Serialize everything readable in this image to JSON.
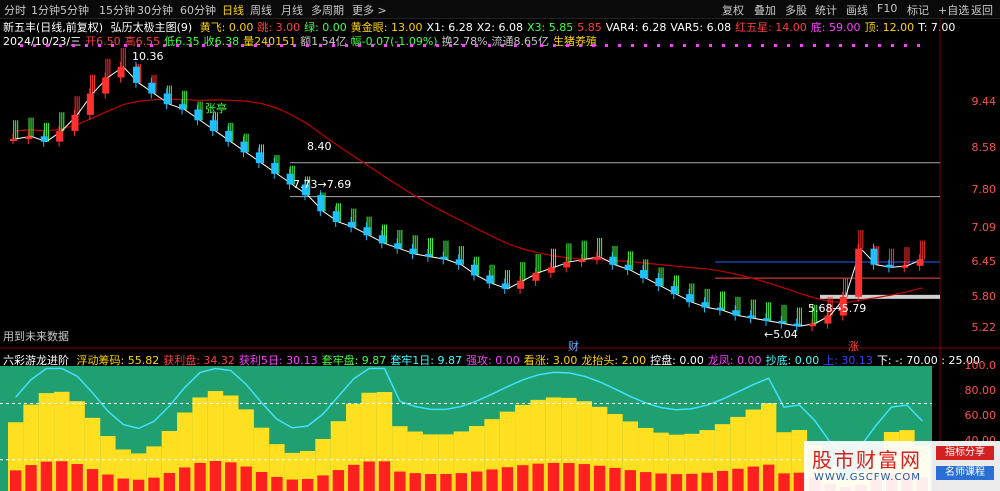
{
  "toolbar": {
    "tabs": [
      "分时",
      "1分钟",
      "5分钟",
      "15分钟",
      "30分钟",
      "60分钟",
      "日线",
      "周线",
      "月线",
      "多周期",
      "更多 >"
    ],
    "active": "日线",
    "right_tabs": [
      "复权",
      "叠加",
      "多股",
      "统计",
      "画线",
      "F10",
      "标记",
      "+自选",
      "返回"
    ]
  },
  "header": {
    "title": "新五丰(日线,前复权)",
    "indicator": "弘历太极主图(9)",
    "items": [
      {
        "label": "黄飞: 0.00",
        "color": "#ffd400"
      },
      {
        "label": "跳: 3.00",
        "color": "#ff4040"
      },
      {
        "label": "绿: 0.00",
        "color": "#40ff40"
      },
      {
        "label": "黄金眼: 13.00",
        "color": "#ffd400"
      },
      {
        "label": "X1: 6.28",
        "color": "#ffffff"
      },
      {
        "label": "X2: 6.08",
        "color": "#ffffff"
      },
      {
        "label": "X3: 5.85",
        "color": "#40ff40"
      },
      {
        "label": "5.85",
        "color": "#ff4040"
      },
      {
        "label": "VAR4: 6.28",
        "color": "#ffffff"
      },
      {
        "label": "VAR5: 6.08",
        "color": "#ffffff"
      },
      {
        "label": "红五星: 14.00",
        "color": "#ff4040"
      },
      {
        "label": "底: 59.00",
        "color": "#ff40ff"
      },
      {
        "label": "顶: 12.00",
        "color": "#ffd400"
      },
      {
        "label": "T: 7.00",
        "color": "#ffffff"
      }
    ],
    "row2": [
      {
        "label": "2024/10/23/三",
        "color": "#ffffff"
      },
      {
        "label": "开6.50",
        "color": "#ff4040"
      },
      {
        "label": "高6.55",
        "color": "#ff4040"
      },
      {
        "label": "低6.35",
        "color": "#40ff40"
      },
      {
        "label": "收6.38",
        "color": "#40ff40"
      },
      {
        "label": "量240151",
        "color": "#ffd400"
      },
      {
        "label": "额1.54亿",
        "color": "#c8c8c8"
      },
      {
        "label": "幅-0.07(-1.09%)",
        "color": "#40ff40"
      },
      {
        "label": "换2.78%",
        "color": "#c8c8c8"
      },
      {
        "label": "流通8.65亿",
        "color": "#c8c8c8"
      },
      {
        "label": "生猪养殖",
        "color": "#ffd400"
      }
    ]
  },
  "annotations": {
    "high": "10.36",
    "level1": "8.40",
    "level2": "7.73→7.69",
    "low": "←5.04",
    "right": "5.68→5.79",
    "future": "用到未来数据",
    "marker_cai": "财",
    "marker_zhang": "涨",
    "zhangting": "张亭"
  },
  "sub_header": {
    "title": "六彩游龙进阶",
    "items": [
      {
        "label": "浮动筹码: 55.82",
        "color": "#ffd400"
      },
      {
        "label": "获利盘: 34.32",
        "color": "#ff4040"
      },
      {
        "label": "获利5日: 30.13",
        "color": "#ff40ff"
      },
      {
        "label": "套牢盘: 9.87",
        "color": "#40ff40"
      },
      {
        "label": "套牢1日: 9.87",
        "color": "#40ffff"
      },
      {
        "label": "强攻: 0.00",
        "color": "#ff40ff"
      },
      {
        "label": "看涨: 3.00",
        "color": "#ffd400"
      },
      {
        "label": "龙抬头: 2.00",
        "color": "#ffd400"
      },
      {
        "label": "控盘: 0.00",
        "color": "#ffffff"
      },
      {
        "label": "龙凤: 0.00",
        "color": "#ff40ff"
      },
      {
        "label": "抄底: 0.00",
        "color": "#40ffff"
      },
      {
        "label": "上: 30.13",
        "color": "#4040ff"
      },
      {
        "label": "下: -: 70.00 : 25.00",
        "color": "#ffffff"
      }
    ]
  },
  "watermark": {
    "title": "股市财富网",
    "url": "WWW.GSCFW.COM",
    "btn1": "指标分享",
    "btn2": "名师课程"
  },
  "chart_data": {
    "type": "candlestick",
    "y_axis_ticks": [
      9.44,
      8.58,
      7.8,
      7.09,
      6.45,
      5.8,
      5.22
    ],
    "sub_y_ticks": [
      100.0,
      80.0,
      60.0,
      40.0
    ],
    "close": [
      8.75,
      8.8,
      8.7,
      8.9,
      9.2,
      9.6,
      9.9,
      10.1,
      9.8,
      9.6,
      9.4,
      9.3,
      9.1,
      8.9,
      8.7,
      8.5,
      8.3,
      8.1,
      7.9,
      7.7,
      7.4,
      7.2,
      7.1,
      6.95,
      6.8,
      6.7,
      6.6,
      6.55,
      6.5,
      6.4,
      6.2,
      6.05,
      5.95,
      6.1,
      6.25,
      6.35,
      6.45,
      6.5,
      6.55,
      6.4,
      6.3,
      6.15,
      6.0,
      5.85,
      5.7,
      5.6,
      5.55,
      5.45,
      5.4,
      5.35,
      5.3,
      5.25,
      5.3,
      5.45,
      5.8,
      6.7,
      6.4,
      6.35,
      6.38,
      6.5
    ]
  }
}
